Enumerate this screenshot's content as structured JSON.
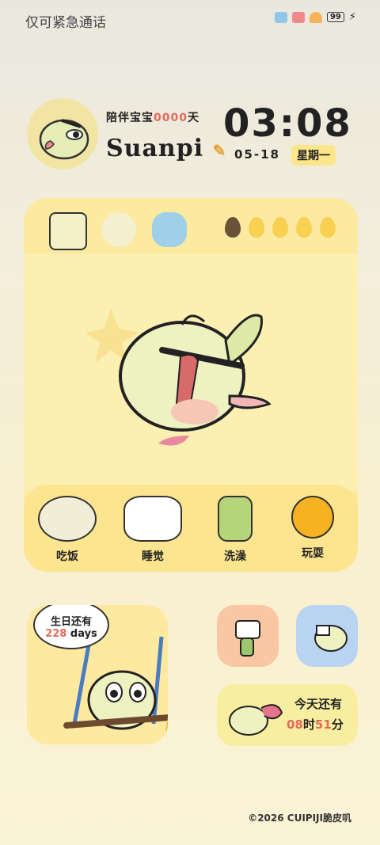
{
  "status_bar": {
    "carrier_text": "仅可紧急通话",
    "battery": "99"
  },
  "profile": {
    "companion_prefix": "陪伴宝宝",
    "companion_days": "0000",
    "companion_suffix": "天",
    "name": "Suanpi"
  },
  "clock": {
    "time": "03:08",
    "date": "05-18",
    "weekday": "星期一"
  },
  "main": {
    "top_icons": [
      "notes-icon",
      "bird-icon",
      "feather-icon"
    ],
    "food_level": {
      "filled": 4,
      "total": 5
    },
    "actions": [
      {
        "label": "吃饭",
        "icon": "plate-icon"
      },
      {
        "label": "睡觉",
        "icon": "pillow-icon"
      },
      {
        "label": "洗澡",
        "icon": "soap-bottle-icon"
      },
      {
        "label": "玩耍",
        "icon": "ball-icon"
      }
    ]
  },
  "birthday": {
    "title": "生日还有",
    "days": "228",
    "unit": "days"
  },
  "countdown": {
    "title": "今天还有",
    "hours": "08",
    "hour_unit": "时",
    "minutes": "51",
    "minute_unit": "分"
  },
  "footer": {
    "copyright": "©2026 CUIPIJI脆皮叽"
  },
  "colors": {
    "accent": "#e06b5a",
    "card": "#fdeaa1",
    "tile_peach": "#f9c7a4",
    "tile_blue": "#b9d4f2"
  }
}
